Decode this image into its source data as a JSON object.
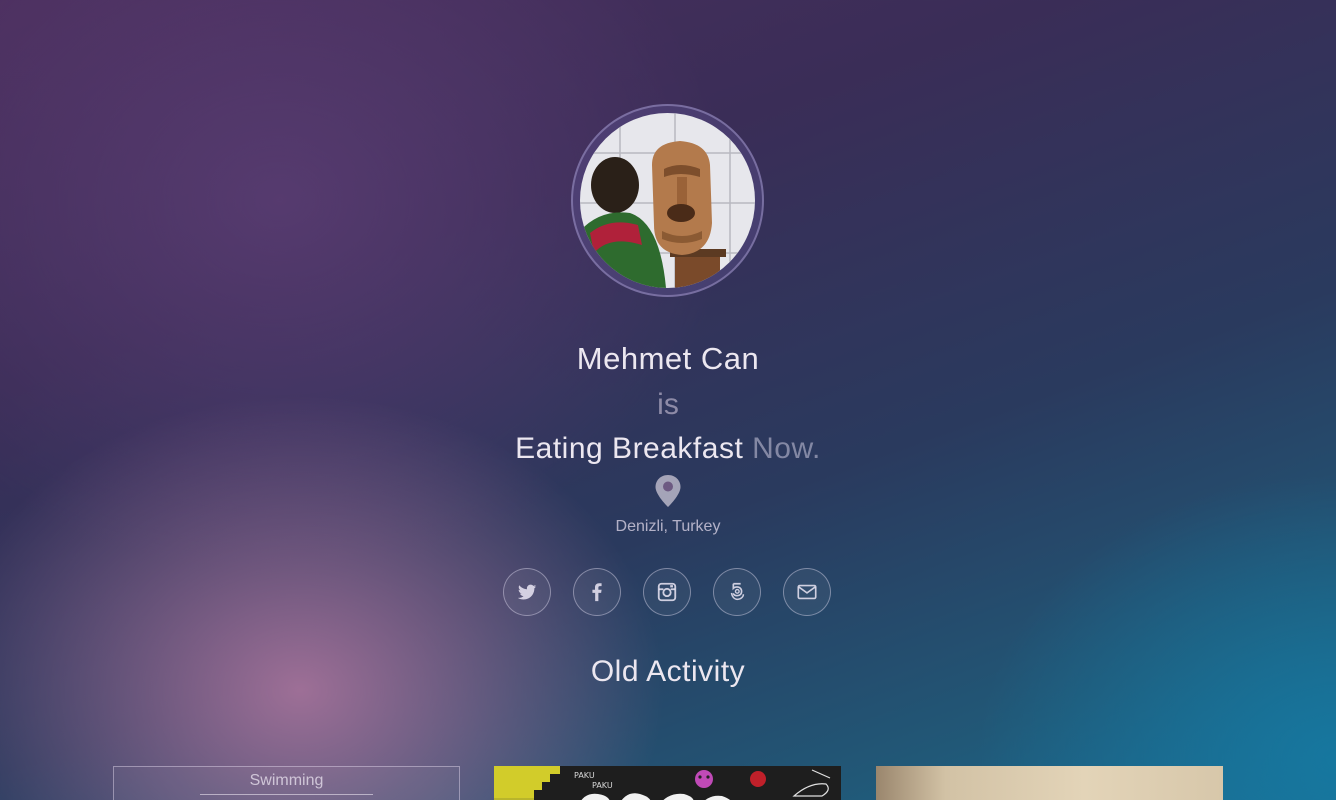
{
  "profile": {
    "name": "Mehmet Can",
    "connector": "is",
    "activity": "Eating Breakfast",
    "time": "Now.",
    "location": "Denizli, Turkey",
    "avatar_alt": "Profile photo"
  },
  "icons": {
    "location": "map-marker-icon"
  },
  "social": [
    {
      "name": "twitter",
      "icon": "twitter-icon"
    },
    {
      "name": "facebook",
      "icon": "facebook-icon"
    },
    {
      "name": "instagram",
      "icon": "instagram-icon"
    },
    {
      "name": "500px",
      "icon": "500px-icon"
    },
    {
      "name": "email",
      "icon": "envelope-icon"
    }
  ],
  "old_activity": {
    "title": "Old Activity",
    "cards": [
      {
        "title": "Swimming"
      },
      {
        "title": ""
      },
      {
        "title": ""
      }
    ]
  },
  "colors": {
    "accent_text": "#ece7f0",
    "muted_text": "#c8bfd6"
  }
}
